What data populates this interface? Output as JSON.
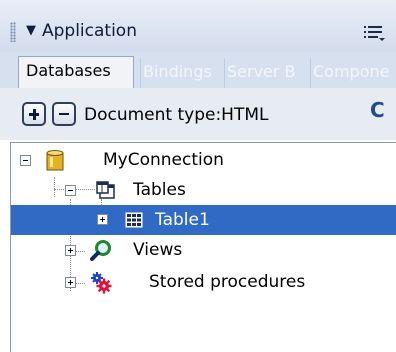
{
  "panel": {
    "title": "Application",
    "tabs": [
      {
        "label": "Databases",
        "active": true
      },
      {
        "label": "Bindings",
        "active": false
      },
      {
        "label": "Server B",
        "active": false
      },
      {
        "label": "Compone",
        "active": false
      }
    ],
    "toolbar": {
      "add_icon": "plus-icon",
      "remove_icon": "minus-icon",
      "document_type": "Document type:HTML",
      "refresh_icon": "refresh-icon"
    }
  },
  "tree": {
    "connection": "MyConnection",
    "tables_label": "Tables",
    "table_item": "Table1",
    "views_label": "Views",
    "procedures_label": "Stored procedures"
  },
  "colors": {
    "selection": "#316ac5",
    "title_gradient_top": "#e9eef8",
    "tab_strip": "#d7e0ef"
  }
}
